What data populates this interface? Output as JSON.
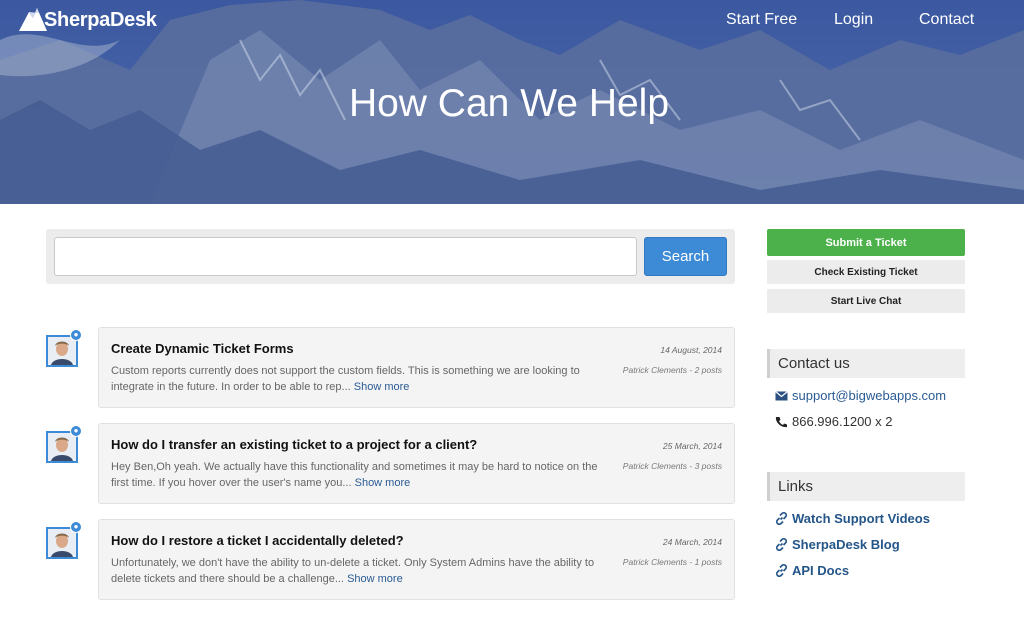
{
  "brand": {
    "name": "SherpaDesk"
  },
  "nav": {
    "start_free": "Start Free",
    "login": "Login",
    "contact": "Contact"
  },
  "hero": {
    "title": "How Can We Help"
  },
  "search": {
    "value": "",
    "placeholder": "",
    "button": "Search"
  },
  "posts": [
    {
      "title": "Create Dynamic Ticket Forms",
      "date": "14 August, 2014",
      "meta": "Patrick Clements - 2 posts",
      "excerpt": "Custom reports currently does not support the custom fields. This is something we are looking to integrate in the future. In order to be able to rep...",
      "show_more": "Show more"
    },
    {
      "title": "How do I transfer an existing ticket to a project for a client?",
      "date": "25 March, 2014",
      "meta": "Patrick Clements - 3 posts",
      "excerpt": "Hey Ben,Oh yeah. We actually have this functionality and sometimes it may be hard to notice on the first time. If you hover over the user's name you...",
      "show_more": "Show more"
    },
    {
      "title": "How do I restore a ticket I accidentally deleted?",
      "date": "24 March, 2014",
      "meta": "Patrick Clements - 1 posts",
      "excerpt": "Unfortunately, we don't have the ability to un-delete a ticket. Only System Admins have the ability to delete tickets and there should be a challenge...",
      "show_more": "Show more"
    }
  ],
  "sidebar": {
    "submit_ticket": "Submit a Ticket",
    "check_ticket": "Check Existing Ticket",
    "live_chat": "Start Live Chat",
    "contact_heading": "Contact us",
    "email": "support@bigwebapps.com",
    "phone": "866.996.1200 x 2",
    "links_heading": "Links",
    "links": [
      "Watch Support Videos",
      "SherpaDesk Blog",
      "API Docs"
    ]
  },
  "colors": {
    "accent_blue": "#3d8ad6",
    "submit_green": "#4cb14b",
    "link_blue": "#245588"
  }
}
